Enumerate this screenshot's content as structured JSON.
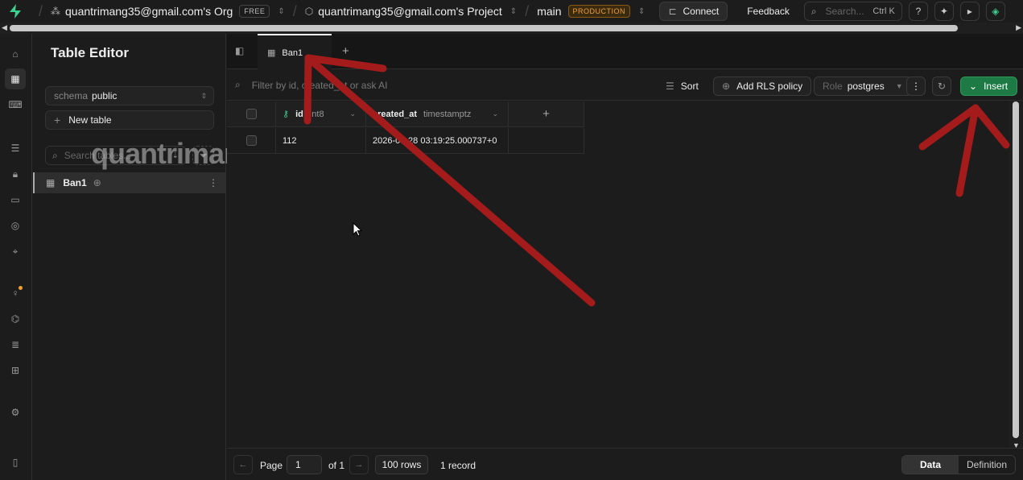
{
  "topbar": {
    "org_name": "quantrimang35@gmail.com's Org",
    "org_badge": "FREE",
    "project_name": "quantrimang35@gmail.com's Project",
    "branch_name": "main",
    "branch_badge": "PRODUCTION",
    "connect_label": "Connect",
    "feedback_label": "Feedback",
    "search_placeholder": "Search...",
    "search_shortcut": "Ctrl K"
  },
  "sidebar": {
    "title": "Table Editor",
    "schema_label": "schema",
    "schema_value": "public",
    "new_table_label": "New table",
    "search_placeholder": "Search tables...",
    "tables": [
      {
        "name": "Ban1"
      }
    ]
  },
  "watermark": "quantrimang",
  "tabs": [
    {
      "label": "Ban1"
    }
  ],
  "toolbar": {
    "filter_placeholder": "Filter by id, created_at or ask AI",
    "sort_label": "Sort",
    "rls_label": "Add RLS policy",
    "role_label": "Role",
    "role_value": "postgres",
    "insert_label": "Insert"
  },
  "grid": {
    "columns": [
      {
        "name": "id",
        "type": "int8",
        "primary_key": true
      },
      {
        "name": "created_at",
        "type": "timestamptz",
        "primary_key": false
      }
    ],
    "rows": [
      {
        "id": "112",
        "created_at": "2026-05-28 03:19:25.000737+0"
      }
    ]
  },
  "footer": {
    "page_label": "Page",
    "page_value": "1",
    "of_label": "of 1",
    "rows_label": "100 rows",
    "records_label": "1 record",
    "view_tabs": [
      "Data",
      "Definition"
    ],
    "active_view": "Data"
  },
  "colors": {
    "background": "#1c1c1c",
    "accent_green": "#3ecf8e",
    "insert_button": "#1d7a44",
    "annotation_arrow": "#a31b1b",
    "production_badge": "#f0a030"
  }
}
